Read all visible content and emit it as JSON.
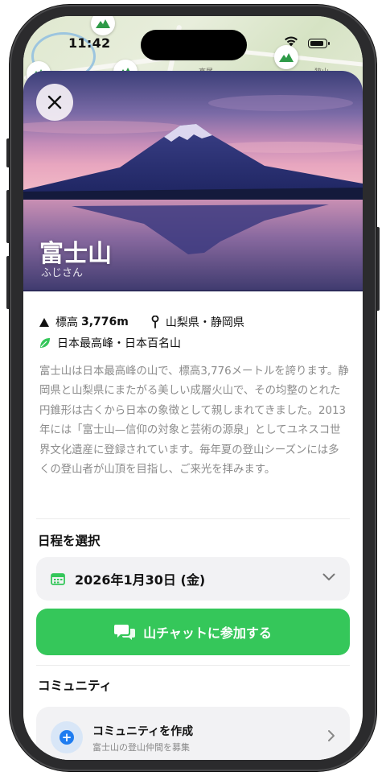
{
  "status": {
    "time": "11:42"
  },
  "map": {
    "labels": [
      "高尾",
      "狭山"
    ]
  },
  "mountain": {
    "name": "富士山",
    "reading": "ふじさん",
    "elevation_label": "標高",
    "elevation_value": "3,776m",
    "location": "山梨県・静岡県",
    "tags": "日本最高峰・日本百名山",
    "description": "富士山は日本最高峰の山で、標高3,776メートルを誇ります。静岡県と山梨県にまたがる美しい成層火山で、その均整のとれた円錐形は古くから日本の象徴として親しまれてきました。2013年には「富士山—信仰の対象と芸術の源泉」としてユネスコ世界文化遺産に登録されています。毎年夏の登山シーズンには多くの登山者が山頂を目指し、ご来光を拝みます。"
  },
  "schedule": {
    "title": "日程を選択",
    "selected_date": "2026年1月30日 (金)"
  },
  "join_button": {
    "label": "山チャットに参加する"
  },
  "community": {
    "title": "コミュニティ",
    "create_title": "コミュニティを作成",
    "create_subtitle": "富士山の登山仲間を募集"
  },
  "colors": {
    "accent_green": "#35c75a",
    "plus_blue": "#1e7cf0"
  }
}
